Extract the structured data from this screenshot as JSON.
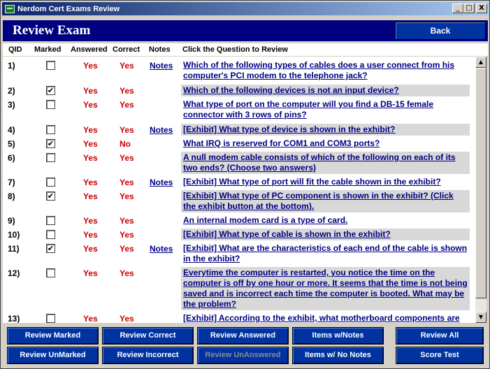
{
  "window": {
    "title": "Nerdom Cert Exams Review",
    "min_label": "_",
    "max_label": "□",
    "close_label": "X"
  },
  "header": {
    "title": "Review Exam",
    "back_label": "Back"
  },
  "columns": {
    "qid": "QID",
    "marked": "Marked",
    "answered": "Answered",
    "correct": "Correct",
    "notes": "Notes",
    "question": "Click the Question to Review"
  },
  "rows": [
    {
      "qid": "1)",
      "marked": false,
      "answered": "Yes",
      "correct": "Yes",
      "notes": "Notes",
      "question": "Which of the following types of cables does a user connect from his computer's PCI modem to the telephone jack?",
      "shaded": false
    },
    {
      "qid": "2)",
      "marked": true,
      "answered": "Yes",
      "correct": "Yes",
      "notes": "",
      "question": "Which of the following devices is not an input device?",
      "shaded": true
    },
    {
      "qid": "3)",
      "marked": false,
      "answered": "Yes",
      "correct": "Yes",
      "notes": "",
      "question": "What type of port on the computer will you find a DB-15 female connector with 3 rows of pins?",
      "shaded": false
    },
    {
      "qid": "4)",
      "marked": false,
      "answered": "Yes",
      "correct": "Yes",
      "notes": "Notes",
      "question": "[Exhibit] What type of device is shown in the exhibit?",
      "shaded": true
    },
    {
      "qid": "5)",
      "marked": true,
      "answered": "Yes",
      "correct": "No",
      "notes": "",
      "question": "What IRQ is reserved for COM1 and COM3 ports?",
      "shaded": false
    },
    {
      "qid": "6)",
      "marked": false,
      "answered": "Yes",
      "correct": "Yes",
      "notes": "",
      "question": "A null modem cable consists of which of the following on each of its two ends? (Choose two answers)",
      "shaded": true
    },
    {
      "qid": "7)",
      "marked": false,
      "answered": "Yes",
      "correct": "Yes",
      "notes": "Notes",
      "question": "[Exhibit] What type of port will fit the cable shown in the exhibit?",
      "shaded": false
    },
    {
      "qid": "8)",
      "marked": true,
      "answered": "Yes",
      "correct": "Yes",
      "notes": "",
      "question": "[Exhibit] What type of PC component is shown in the exhibit? (Click the exhibit button at the bottom).",
      "shaded": true
    },
    {
      "qid": "9)",
      "marked": false,
      "answered": "Yes",
      "correct": "Yes",
      "notes": "",
      "question": "An internal modem card is a type of                         card.",
      "shaded": false
    },
    {
      "qid": "10)",
      "marked": false,
      "answered": "Yes",
      "correct": "Yes",
      "notes": "",
      "question": "[Exhibit] What type of cable is shown in the exhibit?",
      "shaded": true
    },
    {
      "qid": "11)",
      "marked": true,
      "answered": "Yes",
      "correct": "Yes",
      "notes": "Notes",
      "question": "[Exhibit] What are the characteristics of each end of the cable is shown in the exhibit?",
      "shaded": false
    },
    {
      "qid": "12)",
      "marked": false,
      "answered": "Yes",
      "correct": "Yes",
      "notes": "",
      "question": "Everytime the computer is restarted, you notice the time on the computer is off by one hour or more.  It seems that the time is not being saved and is incorrect each time the computer is booted.  What may be the problem?",
      "shaded": true
    },
    {
      "qid": "13)",
      "marked": false,
      "answered": "Yes",
      "correct": "Yes",
      "notes": "",
      "question": "[Exhibit] According to the exhibit, what motherboard components are",
      "shaded": false
    }
  ],
  "buttons": {
    "review_marked": "Review Marked",
    "review_correct": "Review Correct",
    "review_answered": "Review Answered",
    "items_notes": "Items w/Notes",
    "review_all": "Review All",
    "review_unmarked": "Review UnMarked",
    "review_incorrect": "Review Incorrect",
    "review_unanswered": "Review UnAnswered",
    "items_no_notes": "Items w/ No Notes",
    "score_test": "Score Test"
  },
  "colors": {
    "accent": "#000080",
    "button": "#0033a0",
    "answer": "#cc0000"
  }
}
